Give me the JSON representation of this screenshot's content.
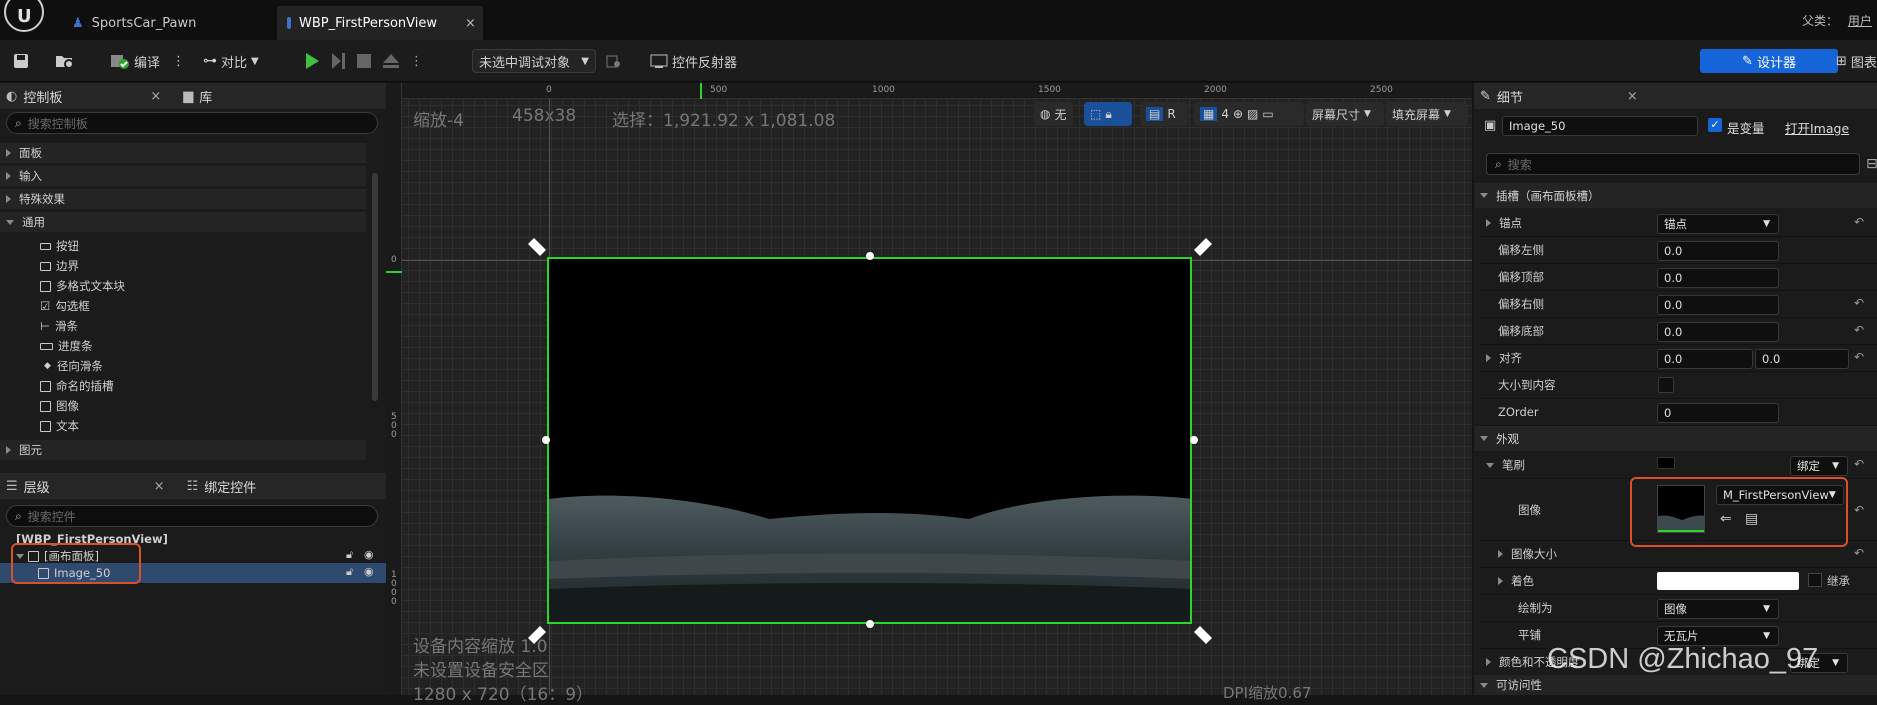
{
  "titlebar": {
    "tabs": [
      {
        "label": "SportsCar_Pawn"
      },
      {
        "label": "WBP_FirstPersonView",
        "close": "×"
      }
    ],
    "parent_label": "父类：",
    "parent_value": "用户"
  },
  "toolbar": {
    "compile": "编译",
    "diff": "对比",
    "debug_target": "未选中调试对象",
    "widget_reflector": "控件反射器",
    "designer": "设计器",
    "graph": "图表",
    "more": "⋮"
  },
  "palette": {
    "tab": "控制板",
    "close": "×",
    "library_tab": "库",
    "search_placeholder": "搜索控制板",
    "categories": [
      "面板",
      "输入",
      "特殊效果",
      "通用"
    ],
    "items": [
      "按钮",
      "边界",
      "多格式文本块",
      "勾选框",
      "滑条",
      "进度条",
      "径向滑条",
      "命名的插槽",
      "图像",
      "文本"
    ],
    "bottom_category": "图元"
  },
  "hierarchy": {
    "tab": "层级",
    "close": "×",
    "bind_tab": "绑定控件",
    "search_placeholder": "搜索控件",
    "root": "[WBP_FirstPersonView]",
    "canvas_panel": "[画布面板]",
    "image": "Image_50"
  },
  "canvas": {
    "zoom": "缩放-4",
    "size": "458x38",
    "selection": "选择：1,921.92 x 1,081.08",
    "ruler_h": [
      "0",
      "500",
      "1000",
      "1500",
      "2000",
      "2500"
    ],
    "ruler_v": [
      "0",
      "5 0 0",
      "1 0 0 0"
    ],
    "view_none": "无",
    "view_r": "R",
    "grid_num": "4",
    "screen_size": "屏幕尺寸",
    "fill_screen": "填充屏幕",
    "footer1": "设备内容缩放 1.0",
    "footer2": "未设置设备安全区",
    "footer3": "1280 x 720（16：9）",
    "dpi": "DPI缩放0.67"
  },
  "details": {
    "tab": "细节",
    "close": "×",
    "name": "Image_50",
    "is_variable": "是变量",
    "open_link": "打开Image",
    "search_placeholder": "搜索",
    "slot_section": "插槽（画布面板槽）",
    "anchors_label": "锚点",
    "anchors_value": "锚点",
    "offset_left_label": "偏移左侧",
    "offset_left": "0.0",
    "offset_top_label": "偏移顶部",
    "offset_top": "0.0",
    "offset_right_label": "偏移右侧",
    "offset_right": "0.0",
    "offset_bottom_label": "偏移底部",
    "offset_bottom": "0.0",
    "alignment_label": "对齐",
    "alignment_x": "0.0",
    "alignment_y": "0.0",
    "size_to_content_label": "大小到内容",
    "zorder_label": "ZOrder",
    "zorder": "0",
    "appearance_section": "外观",
    "brush_label": "笔刷",
    "bind_label": "绑定",
    "image_label": "图像",
    "image_asset": "M_FirstPersonView",
    "image_size_label": "图像大小",
    "tint_label": "着色",
    "inherit_label": "继承",
    "draw_as_label": "绘制为",
    "draw_as_value": "图像",
    "tiling_label": "平铺",
    "tiling_value": "无瓦片",
    "color_opacity_label": "颜色和不透明度",
    "accessibility_label": "可访问性",
    "reset": "↶"
  },
  "watermark": "CSDN @Zhichao_97",
  "colors": {
    "accent": "#1565d8",
    "selection": "#2bd52b",
    "highlight_box": "#d9502b"
  }
}
